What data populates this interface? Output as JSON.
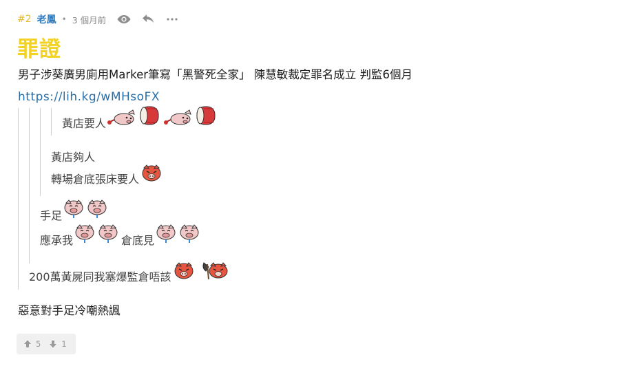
{
  "post": {
    "number": "#2",
    "username": "老鳳",
    "separator": "•",
    "time_ago": "3 個月前",
    "icons": {
      "view": "eye-icon",
      "reply": "reply-icon",
      "more": "more-icon"
    },
    "title": "罪證",
    "body_line": "男子涉葵廣男廁用Marker筆寫「黑警死全家」 陳慧敏裁定罪名成立 判監6個月",
    "link_text": "https://lih.kg/wMHsoFX",
    "quotes": {
      "level3_line1": "黃店要人",
      "level2_line1": "黃店夠人",
      "level2_line2": "轉場倉底張床要人",
      "level1_line1": "手足",
      "level1_line2_a": "應承我",
      "level1_line2_b": "倉底見",
      "level0_line1": "200萬黃屍同我塞爆監倉唔該"
    },
    "last_line": "惡意對手足冷嘲熱諷",
    "votes": {
      "up_count": "5",
      "down_count": "1"
    },
    "colors": {
      "number": "#e8b931",
      "username": "#2f7bbd",
      "title": "#f2d225",
      "link": "#2a6ea6"
    }
  }
}
